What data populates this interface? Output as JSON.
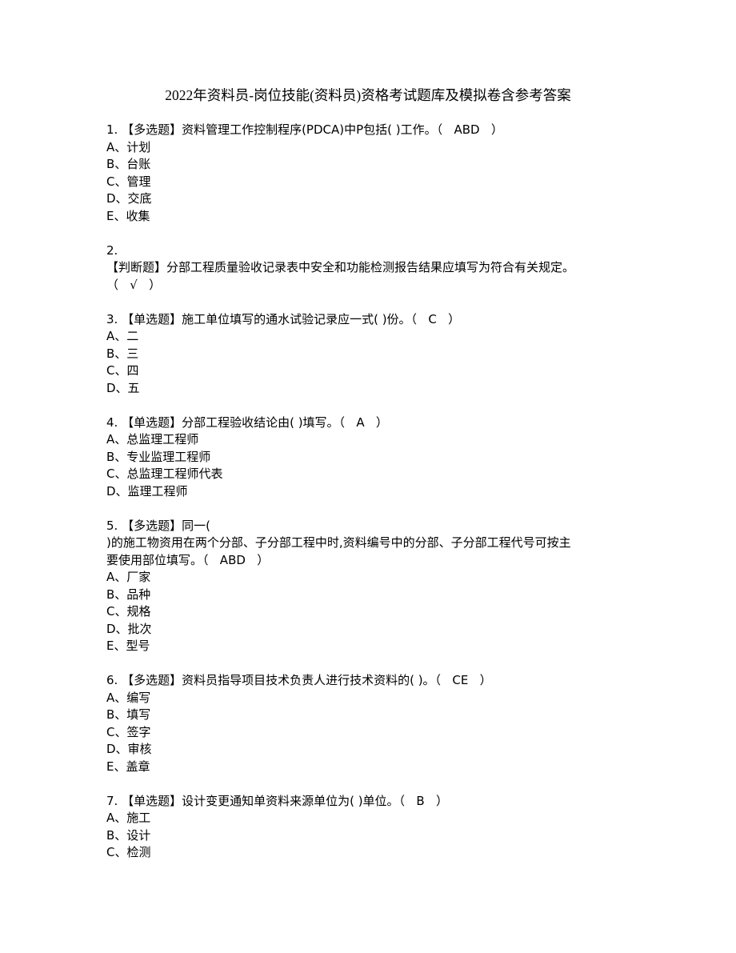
{
  "document": {
    "title": "2022年资料员-岗位技能(资料员)资格考试题库及模拟卷含参考答案",
    "questions": [
      {
        "lines": [
          "1. 【多选题】资料管理工作控制程序(PDCA)中P包括( )工作。（   ABD   ）"
        ],
        "answer": "ABD",
        "options": [
          "A、计划",
          "B、台账",
          "C、管理",
          "D、交底",
          "E、收集"
        ]
      },
      {
        "lines": [
          "2.",
          "【判断题】分部工程质量验收记录表中安全和功能检测报告结果应填写为符合有关规定。",
          "（   √   ）"
        ],
        "answer": "√",
        "options": []
      },
      {
        "lines": [
          "3. 【单选题】施工单位填写的通水试验记录应一式( )份。（   C   ）"
        ],
        "answer": "C",
        "options": [
          "A、二",
          "B、三",
          "C、四",
          "D、五"
        ]
      },
      {
        "lines": [
          "4. 【单选题】分部工程验收结论由( )填写。（   A   ）"
        ],
        "answer": "A",
        "options": [
          "A、总监理工程师",
          "B、专业监理工程师",
          "C、总监理工程师代表",
          "D、监理工程师"
        ]
      },
      {
        "lines": [
          "5. 【多选题】同一(",
          ")的施工物资用在两个分部、子分部工程中时,资料编号中的分部、子分部工程代号可按主",
          "要使用部位填写。（   ABD   ）"
        ],
        "answer": "ABD",
        "options": [
          "A、厂家",
          "B、品种",
          "C、规格",
          "D、批次",
          "E、型号"
        ]
      },
      {
        "lines": [
          "6. 【多选题】资料员指导项目技术负责人进行技术资料的( )。（   CE   ）"
        ],
        "answer": "CE",
        "options": [
          "A、编写",
          "B、填写",
          "C、签字",
          "D、审核",
          "E、盖章"
        ]
      },
      {
        "lines": [
          "7. 【单选题】设计变更通知单资料来源单位为( )单位。（   B   ）"
        ],
        "answer": "B",
        "options": [
          "A、施工",
          "B、设计",
          "C、检测"
        ]
      }
    ]
  }
}
